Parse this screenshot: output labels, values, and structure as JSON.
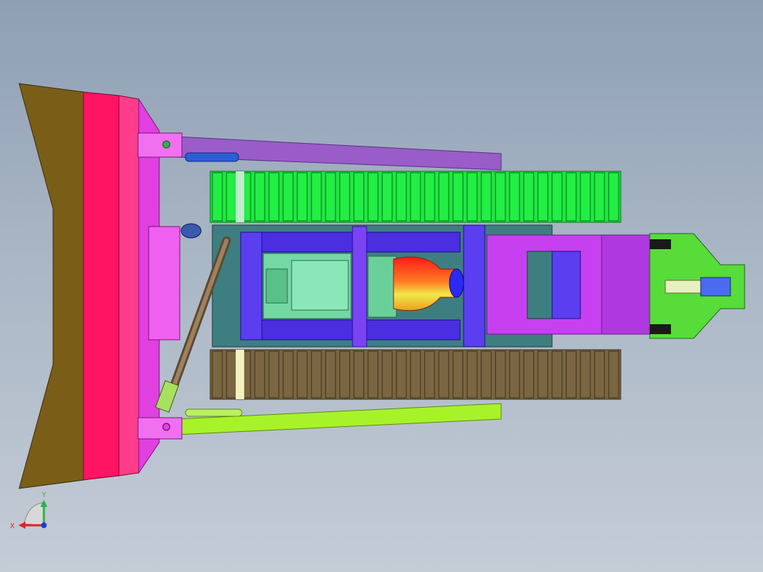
{
  "viewport": {
    "background_top": "#8e9fb4",
    "background_bottom": "#c4ccd6"
  },
  "triad": {
    "x_label": "X",
    "y_label": "Y",
    "x_color": "#e8202a",
    "y_color": "#2bb24c",
    "z_color": "#1c3fd6"
  },
  "colors": {
    "blade_cutting_edge": "#7a5e18",
    "blade_main": "#ff1463",
    "blade_face": "#ff3d8a",
    "push_frame": "#e040e0",
    "push_arm_upper": "#9a5cc8",
    "push_arm_lower": "#a8f22a",
    "track_upper": "#22ee44",
    "track_lower": "#7a6642",
    "main_frame": "#4a2ee0",
    "engine": "#74d8a4",
    "cone_red": "#ff1a1a",
    "cone_yellow": "#f2e84a",
    "rear_frame": "#c640f0",
    "ripper": "#58dc3a",
    "cylinder_rod": "#7a6040"
  }
}
